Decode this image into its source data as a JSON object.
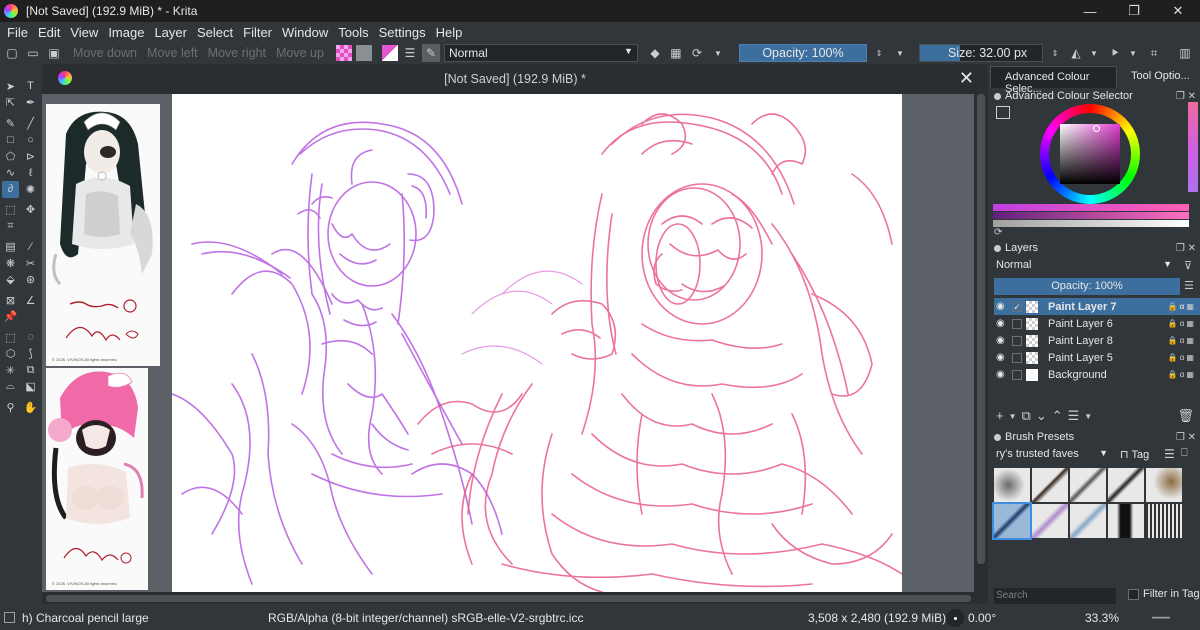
{
  "window": {
    "title": "[Not Saved]  (192.9 MiB) * - Krita",
    "controls": {
      "minimize": "—",
      "restore": "❐",
      "close": "✕"
    }
  },
  "menu": [
    "File",
    "Edit",
    "View",
    "Image",
    "Layer",
    "Select",
    "Filter",
    "Window",
    "Tools",
    "Settings",
    "Help"
  ],
  "toolbar": {
    "move_down": "Move down",
    "move_left": "Move left",
    "move_right": "Move right",
    "move_up": "Move up",
    "blend_mode": "Normal",
    "opacity": "Opacity: 100%",
    "size": "Size: 32.00 px",
    "foreground_color": "#e256d0",
    "background_color": "#8a8f94"
  },
  "document": {
    "tab_title": "[Not Saved]  (192.9 MiB) *",
    "reference_copyright_1": "© 2026. VIVINOS All rights reserved.",
    "reference_copyright_2": "© 2026. VIVINOS All rights reserved."
  },
  "dock": {
    "tabs": [
      "Advanced Colour Selec...",
      "Tool Optio..."
    ],
    "colour_selector_title": "Advanced Colour Selector",
    "layers_title": "Layers",
    "layers_blend": "Normal",
    "layers_opacity": "Opacity:  100%",
    "layers": [
      {
        "name": "Paint Layer 7",
        "selected": true,
        "type": "paint"
      },
      {
        "name": "Paint Layer 6",
        "selected": false,
        "type": "paint"
      },
      {
        "name": "Paint Layer 8",
        "selected": false,
        "type": "paint"
      },
      {
        "name": "Paint Layer 5",
        "selected": false,
        "type": "paint"
      },
      {
        "name": "Background",
        "selected": false,
        "type": "background"
      }
    ],
    "brush_presets_title": "Brush Presets",
    "preset_tag": "ry's trusted faves",
    "tag_label": "Tag",
    "search_placeholder": "Search",
    "filter_in_tag": "Filter in Tag"
  },
  "status": {
    "brush": "h) Charcoal pencil large",
    "color_profile": "RGB/Alpha (8-bit integer/channel)  sRGB-elle-V2-srgbtrc.icc",
    "dimensions": "3,508 x 2,480 (192.9 MiB)",
    "rotation": "0.00°",
    "zoom": "33.3%"
  },
  "colors": {
    "accent": "#3d6f9e",
    "sketch_purple": "#b45be0",
    "sketch_pink": "#e8508a"
  }
}
